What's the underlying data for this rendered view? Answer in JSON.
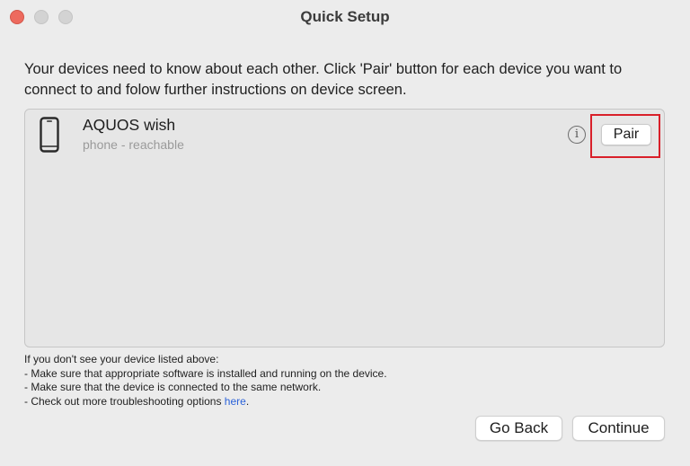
{
  "window": {
    "title": "Quick Setup"
  },
  "instructions": "Your devices need to know about each other. Click 'Pair' button for each device you want to connect to and folow further instructions on device screen.",
  "devices": [
    {
      "name": "AQUOS wish",
      "status": "phone - reachable",
      "icon": "phone-icon",
      "pair_label": "Pair",
      "info_icon": "info-icon"
    }
  ],
  "help": {
    "line1": "If you don't see your device listed above:",
    "line2": "- Make sure that appropriate software is installed and running on the device.",
    "line3": "- Make sure that the device is connected to the same network.",
    "line4_prefix": "- Check out more troubleshooting options ",
    "link_text": "here",
    "line4_suffix": "."
  },
  "buttons": {
    "go_back": "Go Back",
    "continue": "Continue"
  },
  "colors": {
    "highlight": "#d9202a",
    "link": "#2b62d9",
    "close_button": "#ed6a5e"
  }
}
